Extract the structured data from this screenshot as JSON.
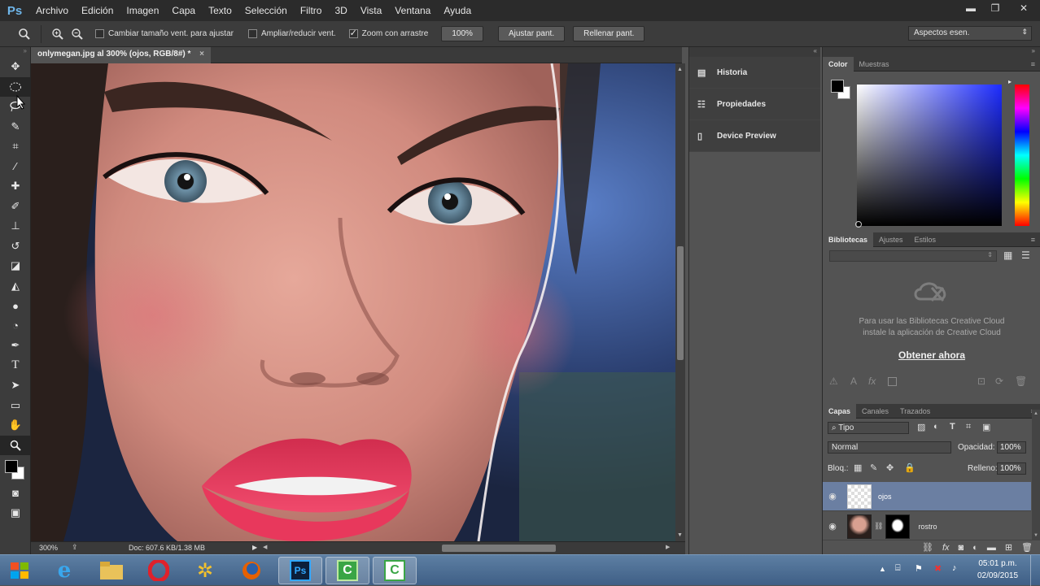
{
  "menubar": {
    "logo": "Ps",
    "items": [
      "Archivo",
      "Edición",
      "Imagen",
      "Capa",
      "Texto",
      "Selección",
      "Filtro",
      "3D",
      "Vista",
      "Ventana",
      "Ayuda"
    ],
    "minimize": "▬",
    "restore": "❐",
    "close": "✕"
  },
  "options": {
    "resize_windows_label": "Cambiar tamaño vent. para ajustar",
    "zoom_all_windows_label": "Ampliar/reducir vent.",
    "scrubby_zoom_label": "Zoom con arrastre",
    "zoom_100_button": "100%",
    "fit_screen_button": "Ajustar pant.",
    "fill_screen_button": "Rellenar pant.",
    "workspace": "Aspectos esen.",
    "resize_windows_checked": false,
    "zoom_all_windows_checked": false,
    "scrubby_zoom_checked": true
  },
  "document": {
    "tab_title": "onlymegan.jpg al 300% (ojos, RGB/8#) *",
    "zoom_level": "300%",
    "doc_info": "Doc: 607.6 KB/1.38 MB"
  },
  "mid_panels": [
    {
      "label": "Historia",
      "icon": "history-icon"
    },
    {
      "label": "Propiedades",
      "icon": "properties-icon"
    },
    {
      "label": "Device Preview",
      "icon": "device-preview-icon"
    }
  ],
  "color_panel": {
    "tabs": [
      "Color",
      "Muestras"
    ],
    "foreground": "#000000",
    "background": "#ffffff",
    "hue_color": "#1d2cff"
  },
  "libraries_panel": {
    "tabs": [
      "Bibliotecas",
      "Ajustes",
      "Estilos"
    ],
    "message_line1": "Para usar las Bibliotecas Creative Cloud",
    "message_line2": "instale la aplicación de Creative Cloud",
    "cta": "Obtener ahora"
  },
  "layers_panel": {
    "tabs": [
      "Capas",
      "Canales",
      "Trazados"
    ],
    "filter_kind": "Tipo",
    "blend_mode": "Normal",
    "opacity_label": "Opacidad:",
    "opacity_value": "100%",
    "lock_label": "Bloq.:",
    "fill_label": "Relleno:",
    "fill_value": "100%",
    "layers": [
      {
        "name": "ojos",
        "selected": true
      },
      {
        "name": "rostro",
        "selected": false
      }
    ]
  },
  "taskbar": {
    "time": "05:01 p.m.",
    "date": "02/09/2015",
    "apps": [
      "windows-start",
      "internet-explorer",
      "file-explorer",
      "opera",
      "app-yellow",
      "firefox",
      "photoshop",
      "camtasia-green",
      "camtasia-white"
    ]
  }
}
